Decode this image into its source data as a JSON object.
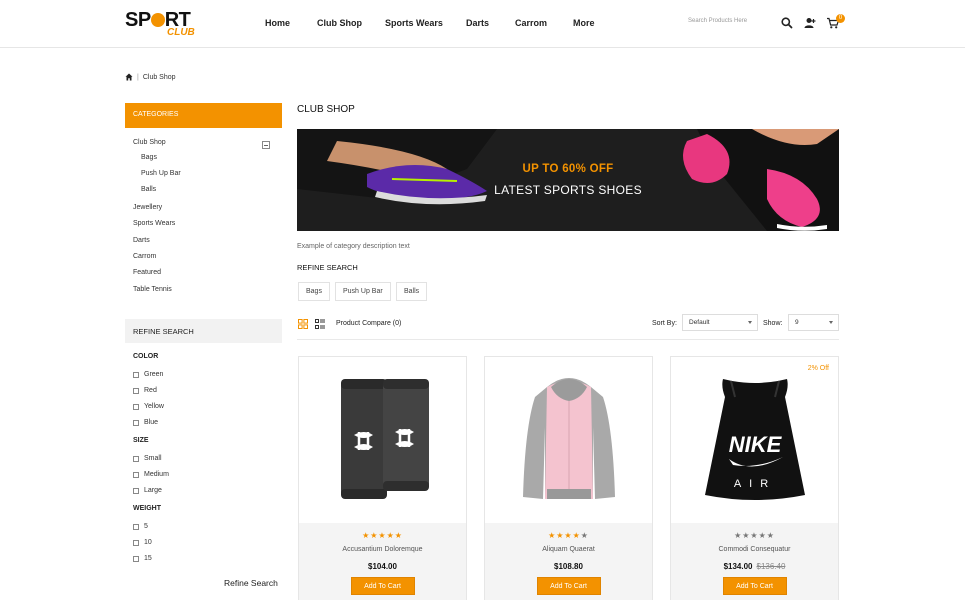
{
  "brand": {
    "logo_main": "SP",
    "logo_main2": "RT",
    "logo_sub": "CLUB"
  },
  "nav": {
    "items": [
      "Home",
      "Club Shop",
      "Sports Wears",
      "Darts",
      "Carrom",
      "More"
    ]
  },
  "header": {
    "search_placeholder": "Search Products Here",
    "cart_count": "0"
  },
  "breadcrumb": {
    "current": "Club Shop",
    "separator": "|"
  },
  "sidebar": {
    "categories_title": "CATEGORIES",
    "categories": [
      {
        "label": "Club Shop",
        "level": 0
      },
      {
        "label": "Bags",
        "level": 1
      },
      {
        "label": "Push Up Bar",
        "level": 1
      },
      {
        "label": "Balls",
        "level": 1
      },
      {
        "label": "Jewellery",
        "level": 0
      },
      {
        "label": "Sports Wears",
        "level": 0
      },
      {
        "label": "Darts",
        "level": 0
      },
      {
        "label": "Carrom",
        "level": 0
      },
      {
        "label": "Featured",
        "level": 0
      },
      {
        "label": "Table Tennis",
        "level": 0
      }
    ],
    "refine_title": "REFINE SEARCH",
    "filters": [
      {
        "title": "COLOR",
        "options": [
          "Green",
          "Red",
          "Yellow",
          "Blue"
        ]
      },
      {
        "title": "SIZE",
        "options": [
          "Small",
          "Medium",
          "Large"
        ]
      },
      {
        "title": "WEIGHT",
        "options": [
          "5",
          "10",
          "15"
        ]
      }
    ],
    "refine_button": "Refine Search"
  },
  "main": {
    "title": "CLUB SHOP",
    "banner_line1": "UP TO 60% OFF",
    "banner_line2": "LATEST SPORTS SHOES",
    "description": "Example of category description text",
    "refine_title": "REFINE SEARCH",
    "refine_chips": [
      "Bags",
      "Push Up Bar",
      "Balls"
    ],
    "compare_label": "Product Compare (0)",
    "sort_label": "Sort By:",
    "sort_value": "Default",
    "show_label": "Show:",
    "show_value": "9"
  },
  "products": [
    {
      "name": "Accusantium Doloremque",
      "price": "$104.00",
      "old_price": "",
      "rating": 5,
      "discount": "",
      "button": "Add To Cart"
    },
    {
      "name": "Aliquam Quaerat",
      "price": "$108.80",
      "old_price": "",
      "rating": 4,
      "discount": "",
      "button": "Add To Cart"
    },
    {
      "name": "Commodi Consequatur",
      "price": "$134.00",
      "old_price": "$136.40",
      "rating": 0,
      "discount": "2% Off",
      "button": "Add To Cart"
    }
  ],
  "colors": {
    "accent": "#f39200",
    "banner_bg": "#1d1d1d",
    "info_bg": "#f4f4f4"
  },
  "product_images": [
    "wristbands",
    "hoodie-pink-grey",
    "drawstring-bag-nike-air"
  ]
}
